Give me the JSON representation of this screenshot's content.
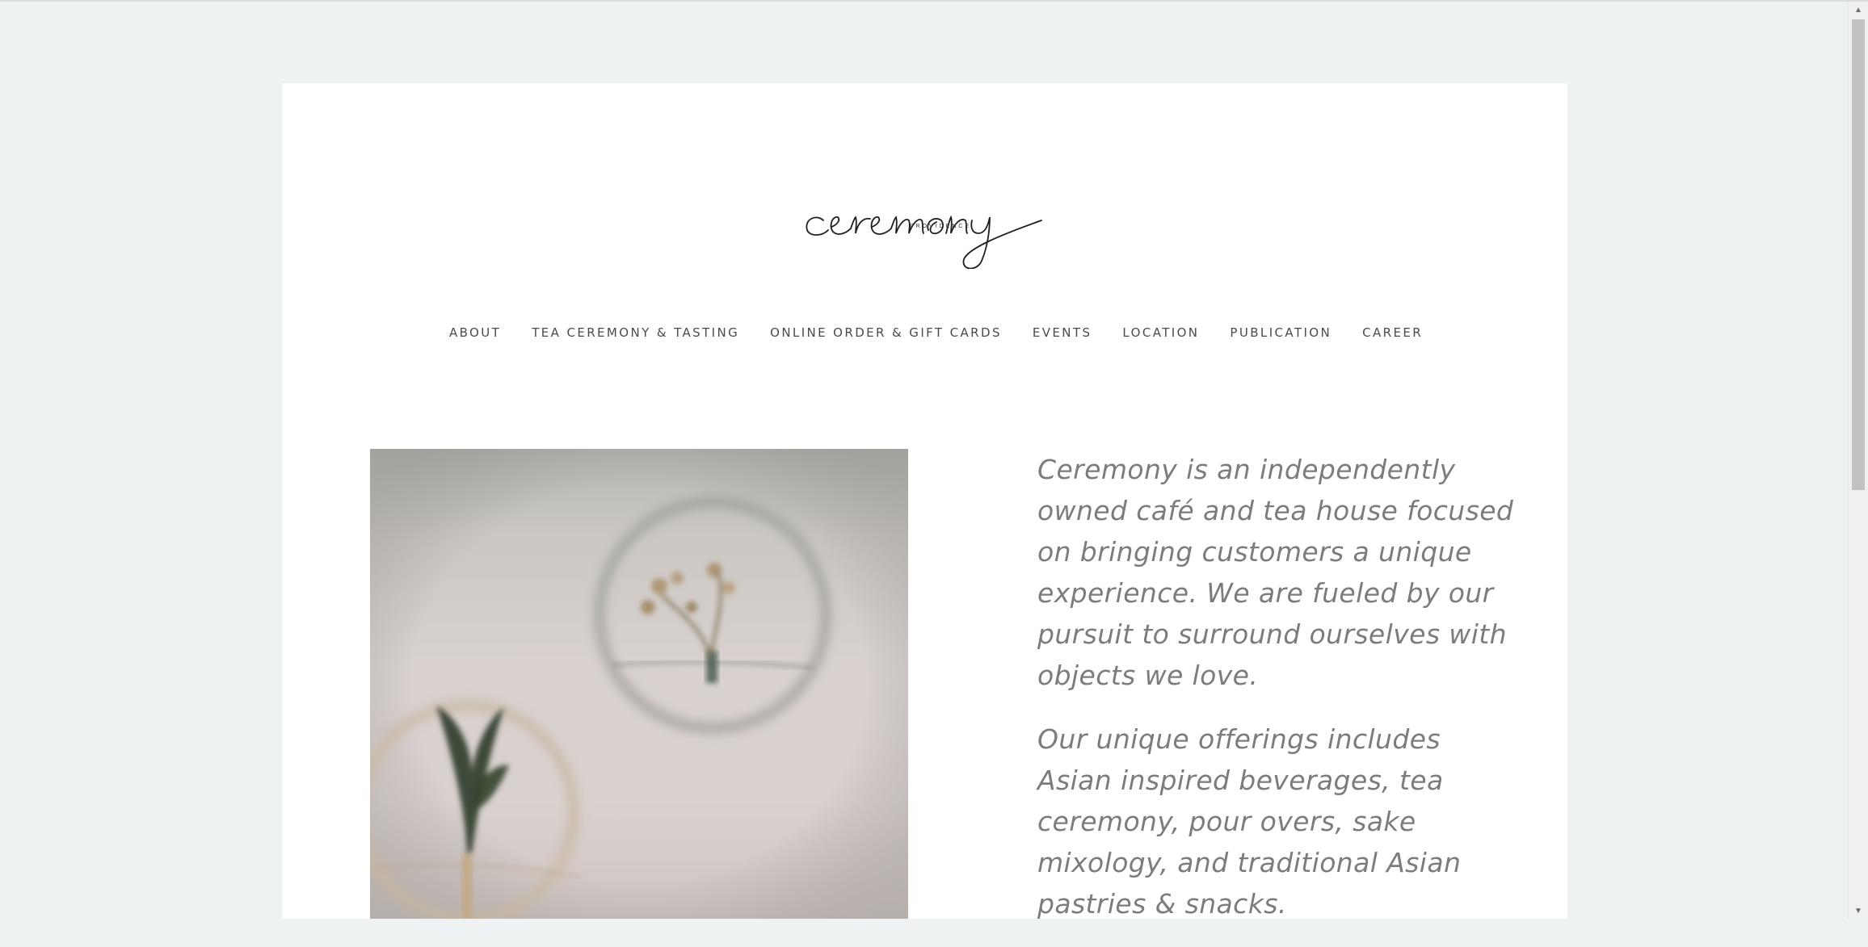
{
  "brand": {
    "logo_script": "ceremony",
    "logo_subtitle": "PROVIDENCE"
  },
  "nav": {
    "items": [
      {
        "label": "ABOUT"
      },
      {
        "label": "TEA CEREMONY & TASTING"
      },
      {
        "label": "ONLINE ORDER & GIFT CARDS"
      },
      {
        "label": "EVENTS"
      },
      {
        "label": "LOCATION"
      },
      {
        "label": "PUBLICATION"
      },
      {
        "label": "CAREER"
      }
    ]
  },
  "intro": {
    "paragraph1": "Ceremony is an independently owned café and tea house focused on bringing customers a unique experience. We are fueled by our pursuit to surround ourselves with objects we love.",
    "paragraph2": "Our unique offerings includes Asian inspired beverages, tea ceremony, pour overs, sake mixology, and traditional Asian pastries & snacks."
  },
  "colors": {
    "page_background": "#eff2f3",
    "content_background": "#ffffff",
    "nav_text": "#4a4a4a",
    "intro_text": "#7c7c7c"
  },
  "scrollbar": {
    "up_icon": "chevron-up-icon",
    "down_icon": "chevron-down-icon"
  }
}
